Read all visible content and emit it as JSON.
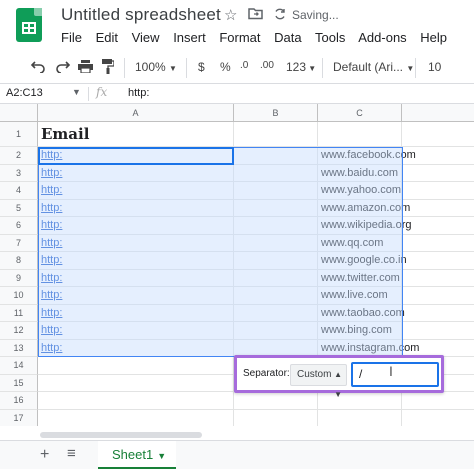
{
  "doc": {
    "title": "Untitled spreadsheet",
    "status": "Saving..."
  },
  "menu": [
    "File",
    "Edit",
    "View",
    "Insert",
    "Format",
    "Data",
    "Tools",
    "Add-ons",
    "Help"
  ],
  "toolbar": {
    "zoom": "100%",
    "currency": "$",
    "percent": "%",
    "decimal_less": ".0",
    "decimal_more": ".00",
    "more_formats": "123",
    "font": "Default (Ari...",
    "font_size": "10"
  },
  "formula_bar": {
    "name_box": "A2:C13",
    "fx": "fx",
    "content": "http:"
  },
  "columns": [
    "A",
    "B",
    "C"
  ],
  "rows": [
    "1",
    "2",
    "3",
    "4",
    "5",
    "6",
    "7",
    "8",
    "9",
    "10",
    "11",
    "12",
    "13",
    "14",
    "15",
    "16",
    "17"
  ],
  "header_cell": "Email",
  "col_a": [
    "http:",
    "http:",
    "http:",
    "http:",
    "http:",
    "http:",
    "http:",
    "http:",
    "http:",
    "http:",
    "http:",
    "http:"
  ],
  "col_c": [
    "www.facebook.com",
    "www.baidu.com",
    "www.yahoo.com",
    "www.amazon.com",
    "www.wikipedia.org",
    "www.qq.com",
    "www.google.co.in",
    "www.twitter.com",
    "www.live.com",
    "www.taobao.com",
    "www.bing.com",
    "www.instagram.com"
  ],
  "separator": {
    "label": "Separator:",
    "selected": "Custom",
    "value": "/"
  },
  "sheet": {
    "tab_name": "Sheet1"
  },
  "colors": {
    "accent": "#1a73e8",
    "highlight": "#a66bdc",
    "sheet_green": "#188038"
  }
}
